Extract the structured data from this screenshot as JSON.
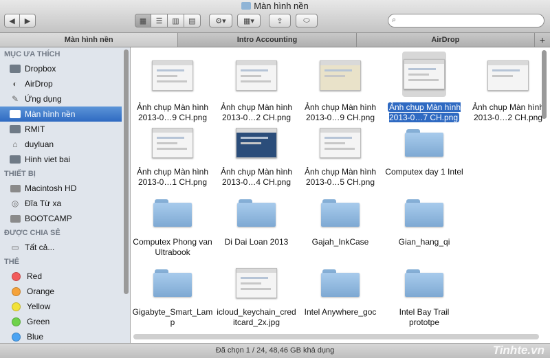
{
  "window": {
    "title": "Màn hình nền"
  },
  "toolbar": {
    "search_placeholder": ""
  },
  "tabs": [
    "Màn hình nền",
    "Intro Accounting",
    "AirDrop"
  ],
  "sidebar": {
    "favorites_heading": "MỤC ƯA THÍCH",
    "favorites": [
      "Dropbox",
      "AirDrop",
      "Ứng dụng",
      "Màn hình nền",
      "RMIT",
      "duyluan",
      "Hinh viet bai"
    ],
    "devices_heading": "THIẾT BỊ",
    "devices": [
      "Macintosh HD",
      "Đĩa Từ xa",
      "BOOTCAMP"
    ],
    "shared_heading": "ĐƯỢC CHIA SẺ",
    "shared": [
      "Tất cả..."
    ],
    "tags_heading": "THẺ",
    "tags": [
      {
        "label": "Red",
        "color": "#f25b5b"
      },
      {
        "label": "Orange",
        "color": "#f5a23a"
      },
      {
        "label": "Yellow",
        "color": "#f2e23a"
      },
      {
        "label": "Green",
        "color": "#6fd24a"
      },
      {
        "label": "Blue",
        "color": "#4aa3f2"
      }
    ]
  },
  "files": [
    {
      "name": "Ảnh chụp Màn hình 2013-0…9 CH.png",
      "kind": "image"
    },
    {
      "name": "Ảnh chụp Màn hình 2013-0…2 CH.png",
      "kind": "image"
    },
    {
      "name": "Ảnh chụp Màn hình 2013-0…9 CH.png",
      "kind": "image"
    },
    {
      "name": "Ảnh chụp Màn hình 2013-0…7 CH.png",
      "kind": "image",
      "selected": true
    },
    {
      "name": "Ảnh chụp Màn hình 2013-0…2 CH.png",
      "kind": "image"
    },
    {
      "name": "Ảnh chụp Màn hình 2013-0…1 CH.png",
      "kind": "image"
    },
    {
      "name": "Ảnh chụp Màn hình 2013-0…4 CH.png",
      "kind": "image"
    },
    {
      "name": "Ảnh chụp Màn hình 2013-0…5 CH.png",
      "kind": "image"
    },
    {
      "name": "Computex day 1 Intel",
      "kind": "folder"
    },
    {
      "name": "Computex Phong van Ultrabook",
      "kind": "folder"
    },
    {
      "name": "Di Dai Loan 2013",
      "kind": "folder"
    },
    {
      "name": "Gajah_InkCase",
      "kind": "folder"
    },
    {
      "name": "Gian_hang_qi",
      "kind": "folder"
    },
    {
      "name": "Gigabyte_Smart_Lamp",
      "kind": "folder"
    },
    {
      "name": "icloud_keychain_creditcard_2x.jpg",
      "kind": "image"
    },
    {
      "name": "Intel Anywhere_goc",
      "kind": "folder"
    },
    {
      "name": "Intel Bay Trail prototpe",
      "kind": "folder"
    }
  ],
  "status": {
    "text": "Đã chọn 1 / 24, 48,46 GB khả dụng",
    "watermark": "Tinhte.vn"
  }
}
